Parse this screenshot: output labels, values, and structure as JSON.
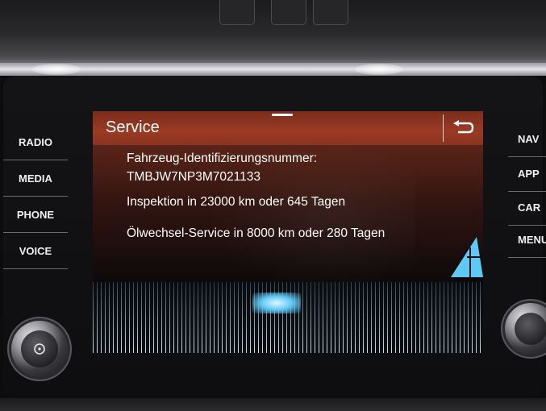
{
  "screen": {
    "title": "Service",
    "vin_label": "Fahrzeug-Identifizierungsnummer:",
    "vin": "TMBJW7NP3M7021133",
    "inspection": "Inspektion in 23000 km oder 645 Tagen",
    "oil_service": "Ölwechsel-Service in 8000 km oder 280 Tagen",
    "back_icon": "back-arrow-icon"
  },
  "left_buttons": [
    "RADIO",
    "MEDIA",
    "PHONE",
    "VOICE"
  ],
  "right_buttons": [
    "NAV",
    "APP",
    "CAR",
    "MENU"
  ],
  "colors": {
    "header": "#9b3a24",
    "text": "#ffffff",
    "accent_blue": "#5fc9f5"
  }
}
